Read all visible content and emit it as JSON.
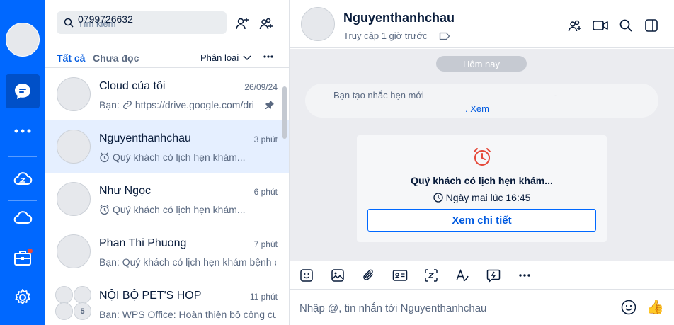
{
  "rail": {
    "accent": "#0068ff",
    "items": [
      "messages-icon",
      "more-icon",
      "zcloud-icon",
      "cloud-icon",
      "toolbox-icon",
      "settings-icon"
    ]
  },
  "list": {
    "search_placeholder": "Tìm kiếm",
    "search_value": "0799726632",
    "tabs": [
      "Tất cả",
      "Chưa đọc"
    ],
    "filter_label": "Phân loại",
    "conversations": [
      {
        "name": "Cloud của tôi",
        "time": "26/09/24",
        "preview_prefix": "Bạn:",
        "preview": "https://drive.google.com/dri"
      },
      {
        "name": "Nguyenthanhchau",
        "time": "3 phút",
        "preview": "Quý khách có lịch hẹn khám..."
      },
      {
        "name": "Như Ngọc",
        "time": "6 phút",
        "preview": "Quý khách có lịch hẹn khám..."
      },
      {
        "name": "Phan Thi Phuong",
        "time": "7 phút",
        "preview": "Bạn: Quý khách có lịch hẹn khám bệnh c"
      },
      {
        "name": "NỘI BỘ PET'S HOP",
        "time": "11 phút",
        "preview": "Bạn: WPS Office: Hoàn thiện bộ công cụ",
        "group_count": "5"
      }
    ]
  },
  "chat": {
    "name": "Nguyenthanhchau",
    "status": "Truy cập 1 giờ trước",
    "day_label": "Hôm nay",
    "notice_text": "Bạn tạo nhắc hẹn mới",
    "notice_dash": "-",
    "notice_link": ". Xem",
    "card": {
      "title": "Quý khách có lịch hẹn khám...",
      "time": "Ngày mai lúc 16:45",
      "button": "Xem chi tiết"
    },
    "composer_placeholder": "Nhập @, tin nhắn tới Nguyenthanhchau",
    "thumb": "👍"
  }
}
